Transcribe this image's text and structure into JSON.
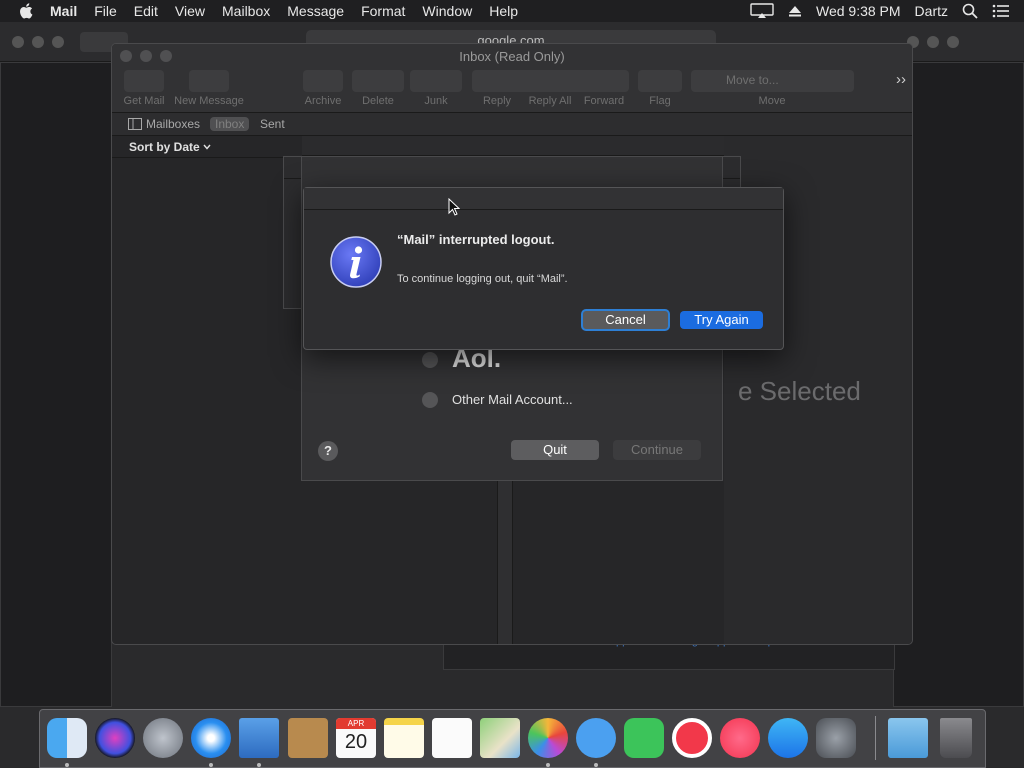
{
  "menubar": {
    "app_name": "Mail",
    "items": [
      "File",
      "Edit",
      "View",
      "Mailbox",
      "Message",
      "Format",
      "Window",
      "Help"
    ],
    "clock": "Wed 9:38 PM",
    "user": "Dartz"
  },
  "safari": {
    "url": "google.com"
  },
  "mail_window": {
    "title": "Inbox (Read Only)",
    "toolbar": {
      "get_mail": "Get Mail",
      "new_message": "New Message",
      "archive": "Archive",
      "delete": "Delete",
      "junk": "Junk",
      "reply": "Reply",
      "reply_all": "Reply All",
      "forward": "Forward",
      "flag": "Flag",
      "move_to": "Move to...",
      "move": "Move"
    },
    "favorites": {
      "mailboxes": "Mailboxes",
      "inbox": "Inbox",
      "sent": "Sent"
    },
    "sort_label": "Sort by Date",
    "no_selection": "e Selected",
    "footer_links": "Create new Apple ID...     Forgot Apple ID or password?"
  },
  "setup_sheet": {
    "aol_label": "Aol.",
    "other_label": "Other Mail Account...",
    "help_label": "?",
    "quit_button": "Quit",
    "continue_button": "Continue"
  },
  "alert": {
    "title": "“Mail” interrupted logout.",
    "message": "To continue logging out, quit “Mail”.",
    "icon": "info-icon",
    "cancel_button": "Cancel",
    "try_again_button": "Try Again",
    "accent_color": "#1b6ce0"
  },
  "dock": {
    "apps": [
      "Finder",
      "Siri",
      "Launchpad",
      "Safari",
      "Mail",
      "Contacts",
      "Calendar",
      "Notes",
      "Reminders",
      "Maps",
      "Photos",
      "Messages",
      "FaceTime",
      "News",
      "Music",
      "App Store",
      "System Preferences",
      "Downloads",
      "Trash"
    ],
    "calendar_month": "APR",
    "calendar_day": "20"
  }
}
